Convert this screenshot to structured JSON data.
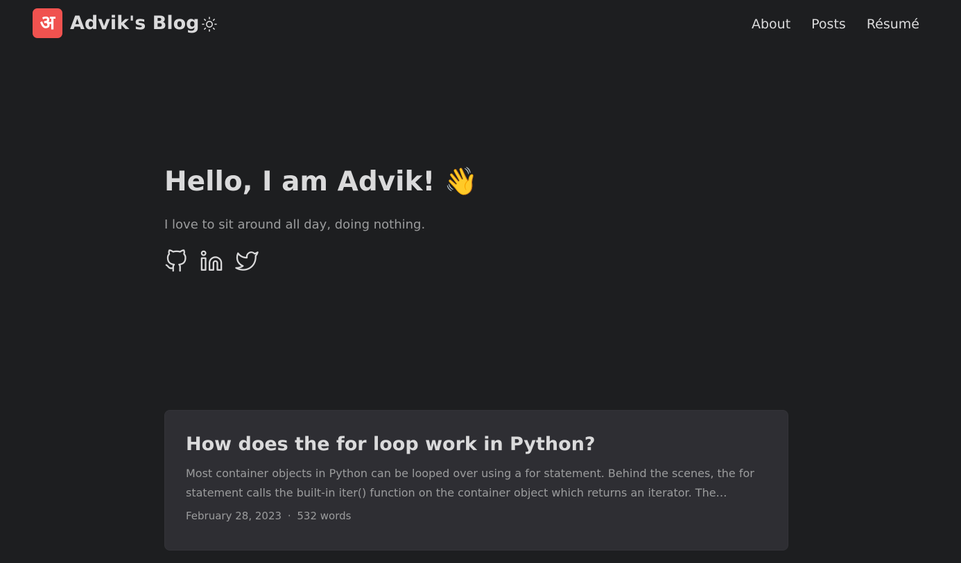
{
  "header": {
    "logo_glyph": "अ",
    "site_title": "Advik's Blog",
    "theme_icon": "sun-icon",
    "nav": [
      {
        "label": "About"
      },
      {
        "label": "Posts"
      },
      {
        "label": "Résumé"
      }
    ]
  },
  "hero": {
    "title": "Hello, I am Advik! 👋",
    "subtitle": "I love to sit around all day, doing nothing.",
    "social": [
      {
        "icon": "github-icon"
      },
      {
        "icon": "linkedin-icon"
      },
      {
        "icon": "twitter-icon"
      }
    ]
  },
  "posts": [
    {
      "title": "How does the for loop work in Python?",
      "summary": "Most container objects in Python can be looped over using a for statement. Behind the scenes, the for statement calls the built-in iter() function on the container object which returns an iterator. The iterator…",
      "date": "February 28, 2023",
      "separator": "·",
      "words": "532 words"
    }
  ],
  "colors": {
    "background": "#1d1e20",
    "card": "#2e2e33",
    "logo_badge": "#f0524f",
    "primary_text": "#dadadb",
    "secondary_text": "#9b9c9d"
  }
}
